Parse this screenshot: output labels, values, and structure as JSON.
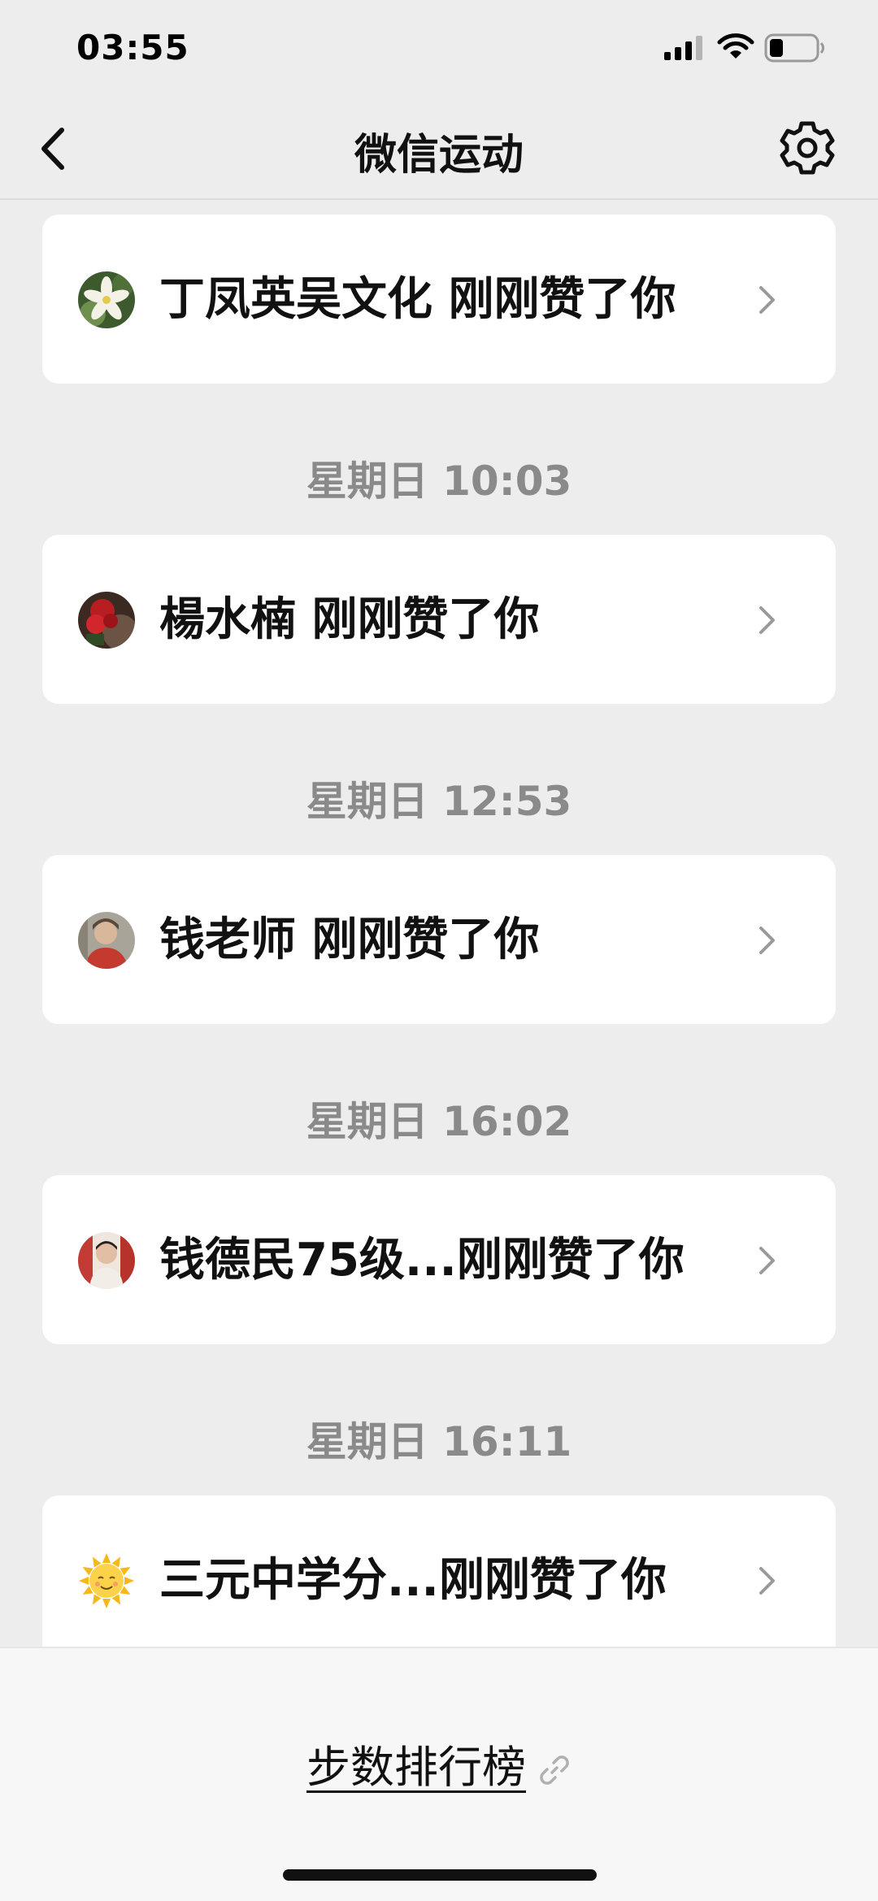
{
  "status_bar": {
    "time": "03:55",
    "signal_icon": "cellular-signal-icon",
    "wifi_icon": "wifi-icon",
    "battery_icon": "battery-icon",
    "battery_level": 0.3
  },
  "nav": {
    "back_icon": "chevron-left-icon",
    "title": "微信运动",
    "settings_icon": "gear-icon"
  },
  "feed": {
    "items": [
      {
        "type": "like",
        "text": "丁凤英吴文化 刚刚赞了你",
        "avatar_icon": "flower-avatar"
      },
      {
        "type": "time",
        "text": "星期日 10:03"
      },
      {
        "type": "like",
        "text": "楊水楠 刚刚赞了你",
        "avatar_icon": "red-flower-avatar"
      },
      {
        "type": "time",
        "text": "星期日 12:53"
      },
      {
        "type": "like",
        "text": "钱老师 刚刚赞了你",
        "avatar_icon": "portrait-avatar"
      },
      {
        "type": "time",
        "text": "星期日 16:02"
      },
      {
        "type": "like",
        "text": "钱德民75级...刚刚赞了你",
        "avatar_icon": "portrait-avatar"
      },
      {
        "type": "time",
        "text": "星期日 16:11"
      },
      {
        "type": "like",
        "text": "三元中学分...刚刚赞了你",
        "avatar_icon": "sun-avatar"
      }
    ]
  },
  "bottom": {
    "leaderboard_label": "步数排行榜",
    "link_icon": "link-icon"
  },
  "colors": {
    "background": "#ededed",
    "card": "#ffffff",
    "time_label": "#8a8a8a",
    "text": "#111111"
  }
}
